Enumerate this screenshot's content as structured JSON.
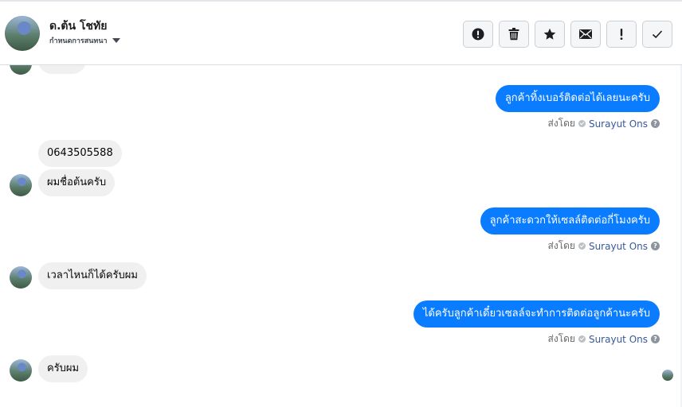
{
  "header": {
    "contact_name": "ด.ต้น โชทัย",
    "assign_label": "กำหนดการสนทนา",
    "actions": [
      {
        "name": "mark-spam-button",
        "icon": "alert-circle-icon"
      },
      {
        "name": "delete-button",
        "icon": "trash-icon"
      },
      {
        "name": "star-button",
        "icon": "star-icon"
      },
      {
        "name": "mark-unread-button",
        "icon": "envelope-icon"
      },
      {
        "name": "follow-up-button",
        "icon": "exclamation-icon"
      },
      {
        "name": "mark-done-button",
        "icon": "checkmark-icon"
      }
    ]
  },
  "messages": [
    {
      "direction": "out",
      "text": "ลูกค้าทิ้งเบอร์ติดต่อได้เลยนะครับ",
      "sent_prefix": "ส่งโดย",
      "sender": "Surayut Ons"
    },
    {
      "direction": "in",
      "text": "0643505588"
    },
    {
      "direction": "in",
      "text": "ผมชื่อต้นครับ"
    },
    {
      "direction": "out",
      "text": "ลูกค้าสะดวกให้เซลล์ติดต่อกี่โมงครับ",
      "sent_prefix": "ส่งโดย",
      "sender": "Surayut Ons"
    },
    {
      "direction": "in",
      "text": "เวลาไหนก็ได้ครับผม"
    },
    {
      "direction": "out",
      "text": "ได้ครับลูกค้าเดี๋ยวเซลล์จะทำการติดต่อลูกค้านะครับ",
      "sent_prefix": "ส่งโดย",
      "sender": "Surayut Ons"
    },
    {
      "direction": "in",
      "text": "ครับผม"
    }
  ],
  "colors": {
    "outgoing_bubble": "#0a7cff",
    "incoming_bubble": "#f0f0f0"
  }
}
